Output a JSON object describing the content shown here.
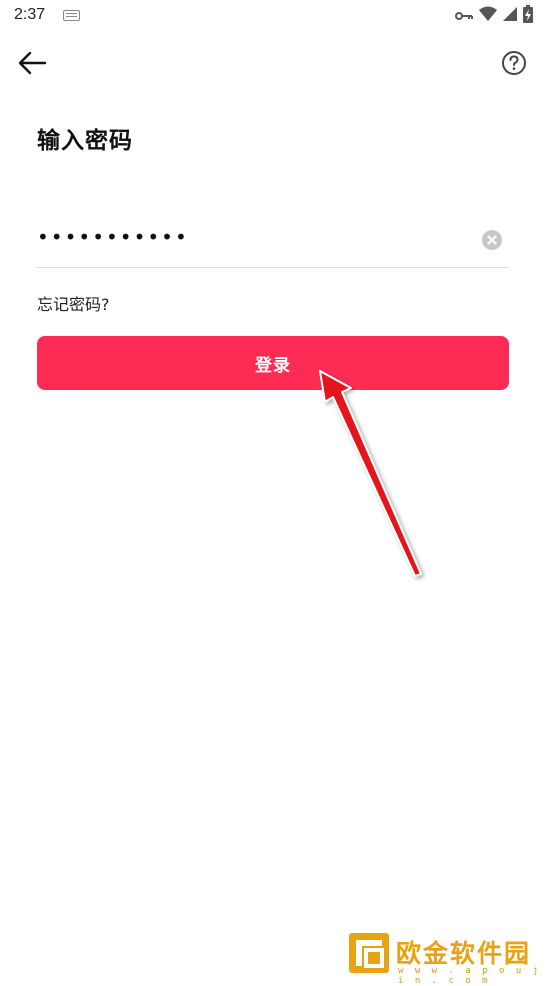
{
  "status_bar": {
    "time": "2:37",
    "icons": [
      "keyboard-icon",
      "vpn-key-icon",
      "wifi-icon",
      "signal-icon",
      "battery-charging-icon"
    ]
  },
  "header": {
    "back_icon": "arrow-left-icon",
    "help_icon": "question-circle-icon"
  },
  "page": {
    "title": "输入密码",
    "password_value": "•••••••••••",
    "clear_icon": "clear-circle-icon",
    "forgot_label": "忘记密码?",
    "login_label": "登录"
  },
  "colors": {
    "accent": "#fe2c55",
    "annotation_arrow": "#e4171f",
    "watermark": "#e8a213"
  },
  "watermark": {
    "text": "欧金软件园",
    "url": "w w w . a p o u j i n . c o m"
  }
}
